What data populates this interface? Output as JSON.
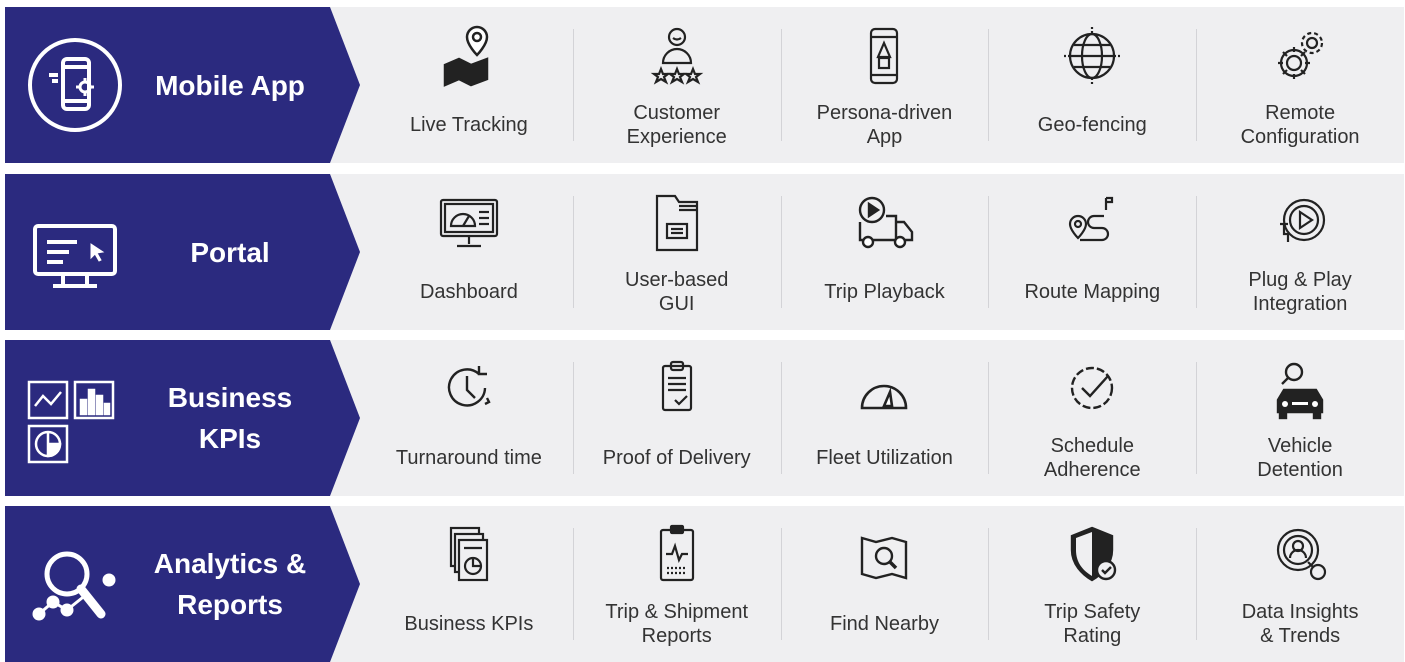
{
  "colors": {
    "banner": "#2b2a7f",
    "row_bg": "#efeff1",
    "text": "#333333",
    "icon_stroke": "#222222"
  },
  "rows": [
    {
      "title": "Mobile App",
      "icon": "mobile-settings-icon",
      "items": [
        {
          "label": "Live Tracking",
          "icon": "map-pin-icon"
        },
        {
          "label": "Customer\nExperience",
          "icon": "customer-rating-icon"
        },
        {
          "label": "Persona-driven\nApp",
          "icon": "phone-persona-icon"
        },
        {
          "label": "Geo-fencing",
          "icon": "globe-fence-icon"
        },
        {
          "label": "Remote\nConfiguration",
          "icon": "gears-icon"
        }
      ]
    },
    {
      "title": "Portal",
      "icon": "monitor-cursor-icon",
      "items": [
        {
          "label": "Dashboard",
          "icon": "dashboard-monitor-icon"
        },
        {
          "label": "User-based\nGUI",
          "icon": "folder-gui-icon"
        },
        {
          "label": "Trip Playback",
          "icon": "truck-play-icon"
        },
        {
          "label": "Route Mapping",
          "icon": "route-icon"
        },
        {
          "label": "Plug & Play\nIntegration",
          "icon": "plug-play-icon"
        }
      ]
    },
    {
      "title": "Business\nKPIs",
      "icon": "kpi-charts-icon",
      "items": [
        {
          "label": "Turnaround time",
          "icon": "clock-arrow-icon"
        },
        {
          "label": "Proof of Delivery",
          "icon": "clipboard-check-icon"
        },
        {
          "label": "Fleet Utilization",
          "icon": "speedometer-icon"
        },
        {
          "label": "Schedule\nAdherence",
          "icon": "clock-check-icon"
        },
        {
          "label": "Vehicle\nDetention",
          "icon": "car-search-icon"
        }
      ]
    },
    {
      "title": "Analytics &\nReports",
      "icon": "magnifier-analytics-icon",
      "items": [
        {
          "label": "Business KPIs",
          "icon": "report-pie-icon"
        },
        {
          "label": "Trip & Shipment\nReports",
          "icon": "clipboard-graph-icon"
        },
        {
          "label": "Find Nearby",
          "icon": "map-search-icon"
        },
        {
          "label": "Trip Safety\nRating",
          "icon": "shield-check-icon"
        },
        {
          "label": "Data Insights\n& Trends",
          "icon": "insights-search-icon"
        }
      ]
    }
  ]
}
